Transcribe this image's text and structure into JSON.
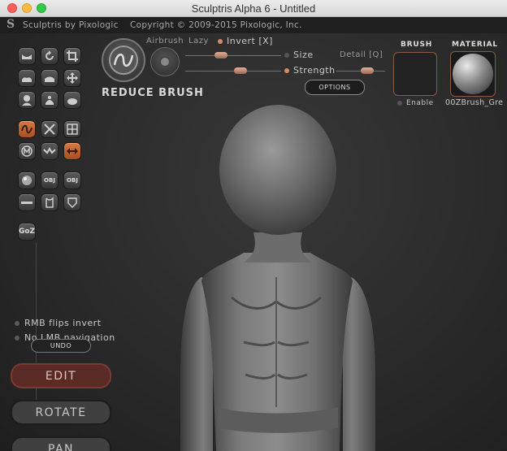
{
  "window": {
    "title": "Sculptris Alpha 6 - Untitled"
  },
  "header": {
    "logo": "S",
    "app_name": "Sculptris by Pixologic",
    "copyright": "Copyright © 2009-2015 Pixologic, Inc."
  },
  "brush_controls": {
    "tool_name": "REDUCE BRUSH",
    "airbrush_label": "Airbrush",
    "lazy_label": "Lazy",
    "invert_label": "Invert [X]",
    "size_label": "Size",
    "detail_label": "Detail [Q]",
    "strength_label": "Strength",
    "options_label": "OPTIONS",
    "brush_title": "BRUSH",
    "enable_label": "Enable",
    "material_title": "MATERIAL",
    "material_name": "00ZBrush_Gre"
  },
  "tools": {
    "goz_label": "GoZ",
    "obj_label": "OBJ",
    "icons": [
      "flat-mesh-icon",
      "rotate-icon",
      "crop-icon",
      "plane-icon",
      "mirror-plane-icon",
      "move-icon",
      "head-icon",
      "bust-icon",
      "blob-icon",
      "draw-icon",
      "cross-icon",
      "grid-icon",
      "inflate-icon",
      "crease-icon",
      "flip-icon",
      "sphere-icon",
      "import-obj-icon",
      "export-obj-icon",
      "flatten-icon",
      "symmetry-icon",
      "paint-icon",
      "goz-icon"
    ]
  },
  "left_panel": {
    "rmb_flips_invert": "RMB flips invert",
    "no_lmb_navigation": "No LMB navigation",
    "undo_label": "UNDO",
    "edit_label": "EDIT",
    "rotate_label": "ROTATE",
    "pan_label": "PAN"
  },
  "colors": {
    "accent": "#d68a62",
    "edit_button": "#5a2a26",
    "background": "#2a2a2a"
  }
}
